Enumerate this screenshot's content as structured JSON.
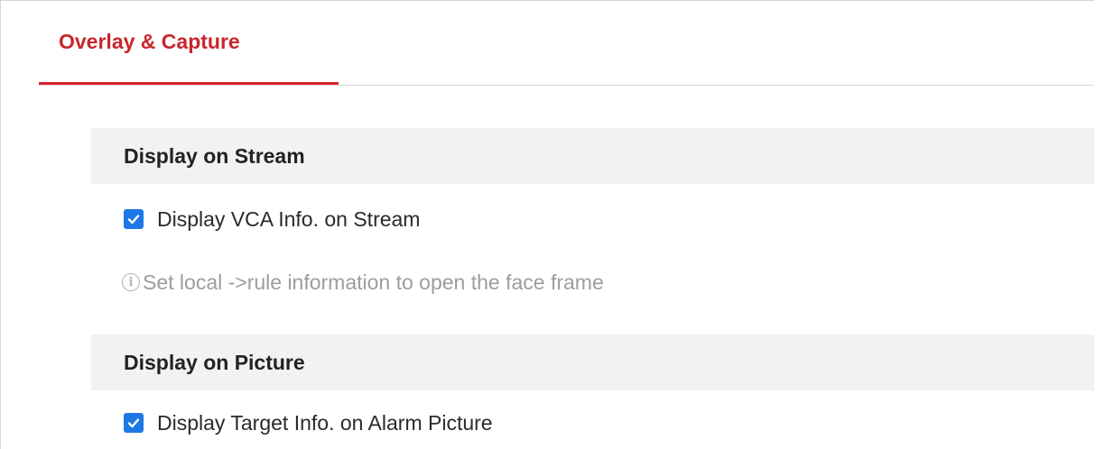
{
  "tabs": [
    {
      "label": "Overlay & Capture",
      "active": true
    }
  ],
  "sections": {
    "stream": {
      "title": "Display on Stream",
      "options": [
        {
          "label": "Display VCA Info. on Stream",
          "checked": true
        }
      ],
      "hint": "Set local ->rule information to open the face frame"
    },
    "picture": {
      "title": "Display on Picture",
      "options": [
        {
          "label": "Display Target Info. on Alarm Picture",
          "checked": true
        }
      ]
    }
  },
  "colors": {
    "accent": "#d9262e",
    "checkbox": "#1e78e6",
    "section_bg": "#f2f2f2",
    "hint": "#9d9d9d"
  },
  "icons": {
    "checkbox": "checkmark-icon",
    "hint": "info-icon"
  }
}
